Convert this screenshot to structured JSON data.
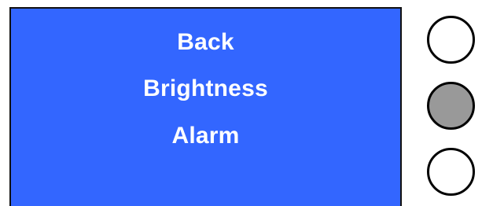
{
  "menu": {
    "items": [
      {
        "label": "Back"
      },
      {
        "label": "Brightness"
      },
      {
        "label": "Alarm"
      }
    ],
    "background_color": "#3366ff",
    "text_color": "#ffffff"
  },
  "side_buttons": [
    {
      "state": "default",
      "color": "#ffffff"
    },
    {
      "state": "pressed",
      "color": "#999999"
    },
    {
      "state": "default",
      "color": "#ffffff"
    }
  ]
}
